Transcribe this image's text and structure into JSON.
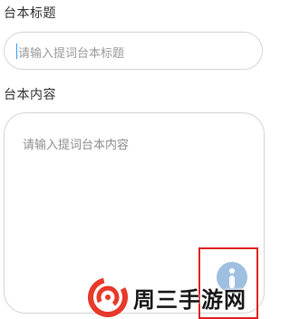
{
  "form": {
    "title_label": "台本标题",
    "title_placeholder": "请输入提词台本标题",
    "content_label": "台本内容",
    "content_placeholder": "请输入提词台本内容"
  },
  "float_button": {
    "icon": "info-icon",
    "color": "#9fbfe0"
  },
  "highlight": {
    "color": "#e02020"
  },
  "watermark": {
    "text": "周三手游网",
    "logo_color": "#e8392a"
  }
}
